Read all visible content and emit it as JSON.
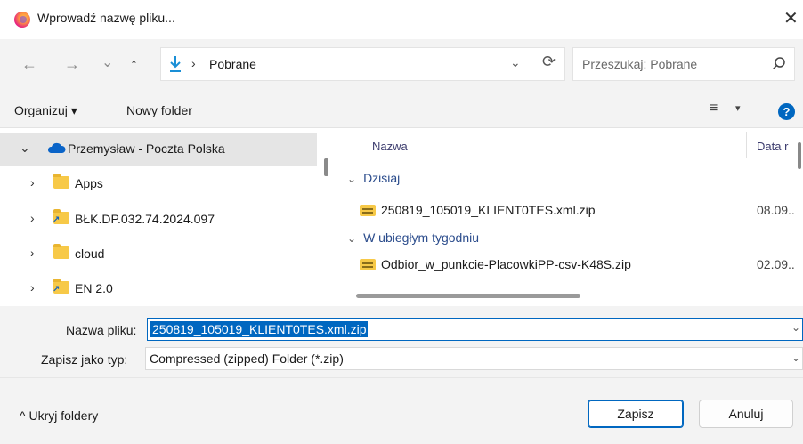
{
  "window": {
    "title": "Wprowadź nazwę pliku...",
    "close_glyph": "✕"
  },
  "nav": {
    "back": "←",
    "forward": "→",
    "recent": "⌄",
    "up": "↑"
  },
  "address": {
    "separator": "›",
    "path": "Pobrane",
    "dropdown": "⌄",
    "refresh": "⟳"
  },
  "search": {
    "placeholder": "Przeszukaj: Pobrane"
  },
  "toolbar": {
    "organize": "Organizuj ▾",
    "new_folder": "Nowy folder",
    "view_glyph": "≡",
    "view_dropdown": "▾",
    "help": "?"
  },
  "tree": [
    {
      "label": "Przemysław - Poczta Polska",
      "chevron": "⌄"
    },
    {
      "label": "Apps",
      "chevron": "›"
    },
    {
      "label": "BŁK.DP.032.74.2024.097",
      "chevron": "›"
    },
    {
      "label": "cloud",
      "chevron": "›"
    },
    {
      "label": "EN 2.0",
      "chevron": "›"
    }
  ],
  "files": {
    "columns": {
      "name": "Nazwa",
      "date": "Data r"
    },
    "groups": [
      {
        "label": "Dzisiaj",
        "chevron": "⌄",
        "items": [
          {
            "name": "250819_105019_KLIENT0TES.xml.zip",
            "date": "08.09.."
          }
        ]
      },
      {
        "label": "W ubiegłym tygodniu",
        "chevron": "⌄",
        "items": [
          {
            "name": "Odbior_w_punkcie-PlacowkiPP-csv-K48S.zip",
            "date": "02.09.."
          }
        ]
      }
    ]
  },
  "form": {
    "filename_label": "Nazwa pliku:",
    "filename_value": "250819_105019_KLIENT0TES.xml.zip",
    "type_label": "Zapisz jako typ:",
    "type_value": "Compressed (zipped) Folder (*.zip)",
    "dropdown": "⌄"
  },
  "footer": {
    "hide_folders": "^ Ukryj foldery",
    "save": "Zapisz",
    "cancel": "Anuluj"
  },
  "colors": {
    "accent": "#0067c0",
    "folder": "#f7c948",
    "selection": "#e5e5e5"
  }
}
